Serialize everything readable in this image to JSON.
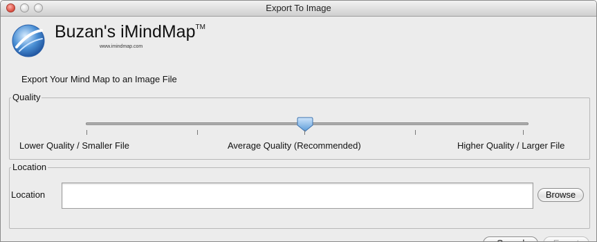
{
  "window": {
    "title": "Export To Image"
  },
  "brand": {
    "name": "Buzan's iMindMap",
    "trademark": "TM",
    "url": "www.imindmap.com"
  },
  "intro": "Export Your Mind Map to an Image File",
  "quality": {
    "legend": "Quality",
    "labels": {
      "low": "Lower Quality / Smaller File",
      "mid": "Average Quality (Recommended)",
      "high": "Higher Quality / Larger File"
    },
    "slider_level_fraction": 0.5,
    "tick_count": 5
  },
  "location": {
    "legend": "Location",
    "label": "Location",
    "value": "",
    "browse_label": "Browse"
  },
  "actions": {
    "cancel_label": "Cancel",
    "export_label": "Export",
    "export_enabled": false
  },
  "colors": {
    "accent": "#5b9bd8",
    "close_light": "#d94b3e"
  }
}
